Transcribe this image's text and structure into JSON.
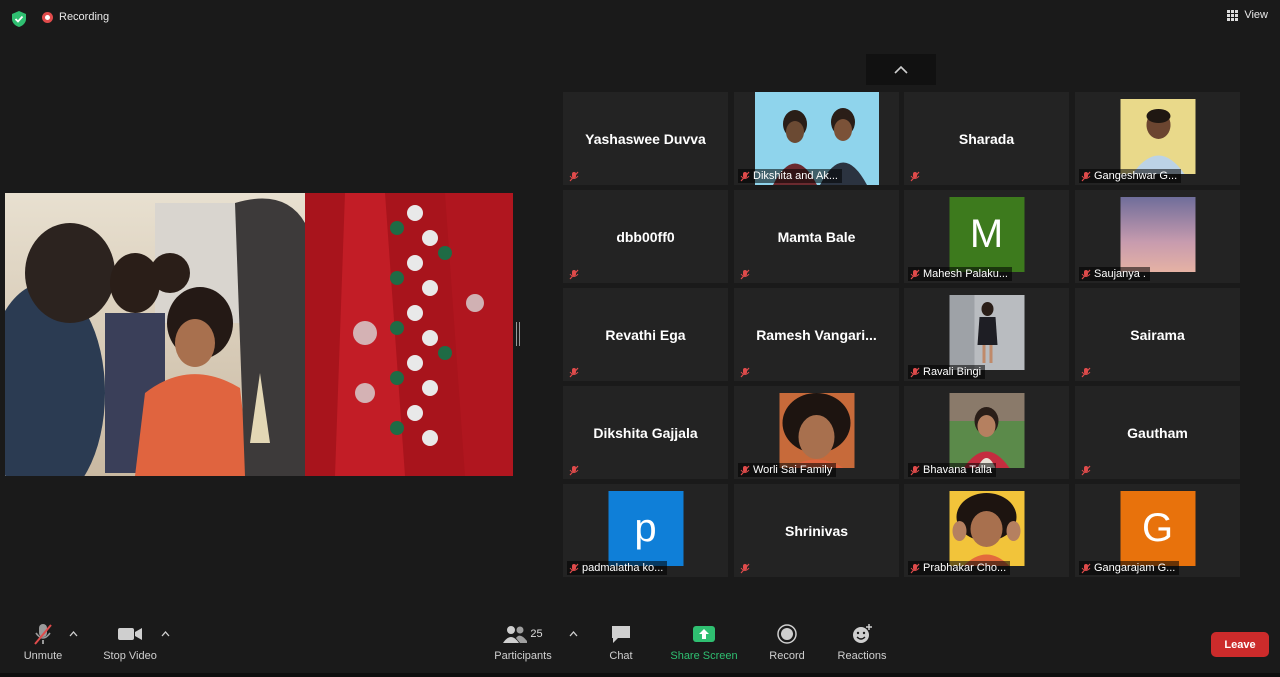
{
  "status": {
    "recording_label": "Recording",
    "view_label": "View",
    "recording_color": "#e04b4b",
    "secure_color": "#2fbf71"
  },
  "gallery": {
    "tiles": [
      {
        "name": "Yashaswee Duvva",
        "kind": "name"
      },
      {
        "name": "Dikshita and Ak...",
        "kind": "video"
      },
      {
        "name": "Sharada",
        "kind": "name"
      },
      {
        "name": "Gangeshwar G...",
        "kind": "photo"
      },
      {
        "name": "dbb00ff0",
        "kind": "name"
      },
      {
        "name": "Mamta Bale",
        "kind": "name"
      },
      {
        "name": "Mahesh Palaku...",
        "kind": "letter",
        "letter": "M",
        "color": "#3d7a1d"
      },
      {
        "name": "Saujanya .",
        "kind": "photo"
      },
      {
        "name": "Revathi Ega",
        "kind": "name"
      },
      {
        "name": "Ramesh  Vangari...",
        "kind": "name"
      },
      {
        "name": "Ravali Bingi",
        "kind": "photo"
      },
      {
        "name": "Sairama",
        "kind": "name"
      },
      {
        "name": "Dikshita Gajjala",
        "kind": "name"
      },
      {
        "name": "Worli Sai Family",
        "kind": "photo"
      },
      {
        "name": "Bhavana Talla",
        "kind": "photo"
      },
      {
        "name": "Gautham",
        "kind": "name"
      },
      {
        "name": "padmalatha ko...",
        "kind": "letter",
        "letter": "p",
        "color": "#0f7fd8"
      },
      {
        "name": "Shrinivas",
        "kind": "name"
      },
      {
        "name": "Prabhakar Cho...",
        "kind": "photo"
      },
      {
        "name": "Gangarajam G...",
        "kind": "letter",
        "letter": "G",
        "color": "#e8720c"
      }
    ]
  },
  "toolbar": {
    "unmute_label": "Unmute",
    "stop_video_label": "Stop Video",
    "participants_label": "Participants",
    "participants_count": "25",
    "chat_label": "Chat",
    "share_screen_label": "Share Screen",
    "record_label": "Record",
    "reactions_label": "Reactions",
    "leave_label": "Leave",
    "share_color": "#2fbf71",
    "leave_color": "#cc2b2b"
  }
}
